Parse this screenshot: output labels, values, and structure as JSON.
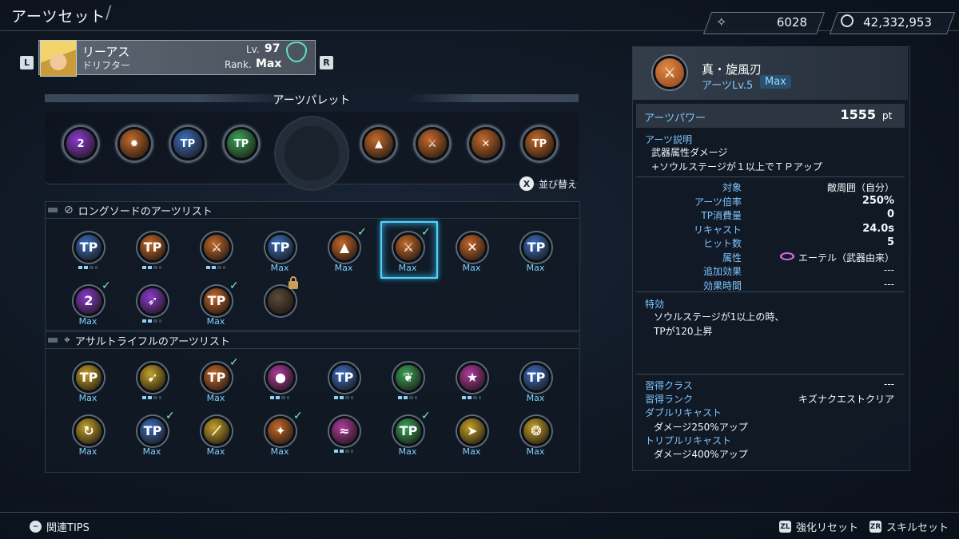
{
  "header": {
    "title": "アーツセット",
    "currency_a": "6028",
    "currency_b": "42,332,953"
  },
  "character": {
    "name": "リーアス",
    "class": "ドリフター",
    "level_label": "Lv.",
    "level": "97",
    "rank_label": "Rank.",
    "rank": "Max",
    "shoulder_left": "L",
    "shoulder_right": "R"
  },
  "palette": {
    "title": "アーツパレット",
    "sort_button": "X",
    "sort_label": "並び替え",
    "slots": [
      {
        "icon": "swirl-2-icon",
        "color": "#8b3bd0",
        "text": "2"
      },
      {
        "icon": "burst-icon",
        "color": "#c56a2b",
        "text": "✹"
      },
      {
        "icon": "tp-blade-icon",
        "color": "#3a6fc2",
        "text": "TP"
      },
      {
        "icon": "tp-shield-icon",
        "color": "#3aa55a",
        "text": "TP"
      },
      {
        "icon": "dome-icon",
        "color": "#c56a2b",
        "text": "▲"
      },
      {
        "icon": "whirl-blade-icon",
        "color": "#c56a2b",
        "text": "⚔"
      },
      {
        "icon": "cross-slash-icon",
        "color": "#c56a2b",
        "text": "✕"
      },
      {
        "icon": "tp-flower-icon",
        "color": "#c56a2b",
        "text": "TP"
      }
    ]
  },
  "longsword": {
    "title": "ロングソードのアーツリスト",
    "items": [
      {
        "icon": "tp-flame-icon",
        "color": "#3a6fc2",
        "text": "TP",
        "status": "bar-half",
        "check": false
      },
      {
        "icon": "tp-burst-icon",
        "color": "#c56a2b",
        "text": "TP",
        "status": "bar-half",
        "check": false
      },
      {
        "icon": "dash-blade-icon",
        "color": "#c56a2b",
        "text": "⚔",
        "status": "bar-half",
        "check": false
      },
      {
        "icon": "tp-ring-icon",
        "color": "#3a6fc2",
        "text": "TP",
        "status": "Max",
        "check": false
      },
      {
        "icon": "dome-icon",
        "color": "#c56a2b",
        "text": "▲",
        "status": "Max",
        "check": true
      },
      {
        "icon": "whirl-blade-icon",
        "color": "#c56a2b",
        "text": "⚔",
        "status": "Max",
        "check": true,
        "selected": true
      },
      {
        "icon": "cross-slash-icon",
        "color": "#c56a2b",
        "text": "✕",
        "status": "Max",
        "check": false
      },
      {
        "icon": "tp-heart-icon",
        "color": "#3a6fc2",
        "text": "TP",
        "status": "Max",
        "check": false
      },
      {
        "icon": "swirl-2-icon",
        "color": "#8b3bd0",
        "text": "2",
        "status": "Max",
        "check": true
      },
      {
        "icon": "spike-icon",
        "color": "#8b3bd0",
        "text": "➶",
        "status": "bar-half",
        "check": false
      },
      {
        "icon": "tp-flower-icon",
        "color": "#c56a2b",
        "text": "TP",
        "status": "Max",
        "check": true
      },
      {
        "icon": "locked-art-icon",
        "color": "#5b4a3a",
        "text": "",
        "status": "",
        "check": false,
        "locked": true
      }
    ]
  },
  "rifle": {
    "title": "アサルトライフルのアーツリスト",
    "items": [
      {
        "icon": "tp-sun-icon",
        "color": "#c5a22b",
        "text": "TP",
        "status": "Max",
        "check": false
      },
      {
        "icon": "rifle-shot-icon",
        "color": "#c5a22b",
        "text": "➹",
        "status": "bar-half",
        "check": false
      },
      {
        "icon": "tp-rifle-icon",
        "color": "#c56a2b",
        "text": "TP",
        "status": "Max",
        "check": true
      },
      {
        "icon": "impact-icon",
        "color": "#b03ba0",
        "text": "●",
        "status": "bar-half",
        "check": false
      },
      {
        "icon": "tp-arrow-up-icon",
        "color": "#3a6fc2",
        "text": "TP",
        "status": "bar-half",
        "check": false
      },
      {
        "icon": "leaf-icon",
        "color": "#3aa55a",
        "text": "❦",
        "status": "bar-half",
        "check": false
      },
      {
        "icon": "star-icon",
        "color": "#b03ba0",
        "text": "★",
        "status": "bar-half",
        "check": false
      },
      {
        "icon": "tp-chat-icon",
        "color": "#3a6fc2",
        "text": "TP",
        "status": "Max",
        "check": false
      },
      {
        "icon": "sweep-icon",
        "color": "#c5a22b",
        "text": "↻",
        "status": "Max",
        "check": false
      },
      {
        "icon": "tp-edge-icon",
        "color": "#3a6fc2",
        "text": "TP",
        "status": "Max",
        "check": true
      },
      {
        "icon": "laser-icon",
        "color": "#c5a22b",
        "text": "⟋",
        "status": "Max",
        "check": false
      },
      {
        "icon": "flare-icon",
        "color": "#c56a2b",
        "text": "✦",
        "status": "Max",
        "check": true
      },
      {
        "icon": "wave-icon",
        "color": "#b03ba0",
        "text": "≈",
        "status": "bar-half",
        "check": false
      },
      {
        "icon": "tp-wings-icon",
        "color": "#3aa55a",
        "text": "TP",
        "status": "Max",
        "check": true
      },
      {
        "icon": "shot-icon",
        "color": "#c5a22b",
        "text": "➤",
        "status": "Max",
        "check": false
      },
      {
        "icon": "orbs-icon",
        "color": "#c5a22b",
        "text": "❂",
        "status": "Max",
        "check": false
      }
    ]
  },
  "detail": {
    "art_name": "真・旋風刃",
    "art_level": "アーツLv.5",
    "art_level_badge": "Max",
    "power_label": "アーツパワー",
    "power_value": "1555",
    "power_unit": "pt",
    "desc_label": "アーツ説明",
    "desc_line1": "武器属性ダメージ",
    "desc_line2": "+ソウルステージが１以上でＴＰアップ",
    "stats": [
      {
        "key": "対象",
        "val": "敵周囲（自分）"
      },
      {
        "key": "アーツ倍率",
        "val": "250%"
      },
      {
        "key": "TP消費量",
        "val": "0"
      },
      {
        "key": "リキャスト",
        "val": "24.0s"
      },
      {
        "key": "ヒット数",
        "val": "5"
      },
      {
        "key": "属性",
        "val": "エーテル（武器由来）"
      },
      {
        "key": "追加効果",
        "val": "---"
      },
      {
        "key": "効果時間",
        "val": "---"
      }
    ],
    "trait_label": "特効",
    "trait_line1": "ソウルステージが1以上の時、",
    "trait_line2": "TPが120上昇",
    "learn_class_label": "習得クラス",
    "learn_class_val": "---",
    "learn_rank_label": "習得ランク",
    "learn_rank_val": "キズナクエストクリア",
    "double_label": "ダブルリキャスト",
    "double_val": "ダメージ250%アップ",
    "triple_label": "トリプルリキャスト",
    "triple_val": "ダメージ400%アップ"
  },
  "footer": {
    "tips_icon": "−",
    "tips_label": "関連TIPS",
    "reset_icon": "ZL",
    "reset_label": "強化リセット",
    "skill_icon": "ZR",
    "skill_label": "スキルセット"
  }
}
